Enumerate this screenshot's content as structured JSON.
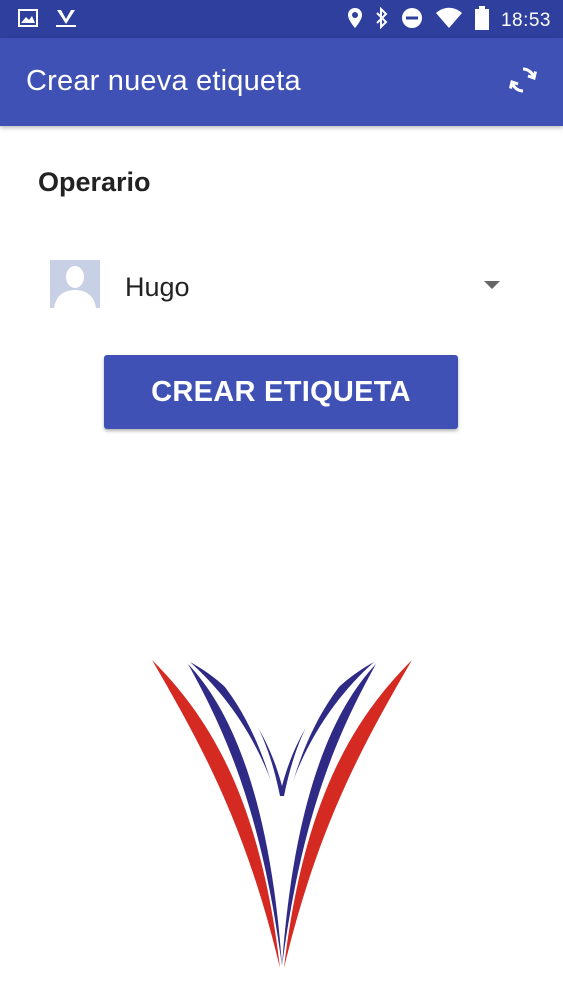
{
  "status_bar": {
    "time": "18:53",
    "icons": [
      "image-icon",
      "app-logo-icon",
      "location-icon",
      "bluetooth-icon",
      "do-not-disturb-icon",
      "wifi-icon",
      "battery-icon"
    ]
  },
  "app_bar": {
    "title": "Crear nueva etiqueta",
    "refresh_icon": "refresh-icon"
  },
  "form": {
    "operator_label": "Operario",
    "operator_selected": "Hugo",
    "create_button_label": "CREAR ETIQUETA"
  },
  "colors": {
    "primary": "#3f51b5",
    "primary_dark": "#2f3f9e",
    "logo_red": "#d42a22",
    "logo_blue": "#2e2a86"
  }
}
